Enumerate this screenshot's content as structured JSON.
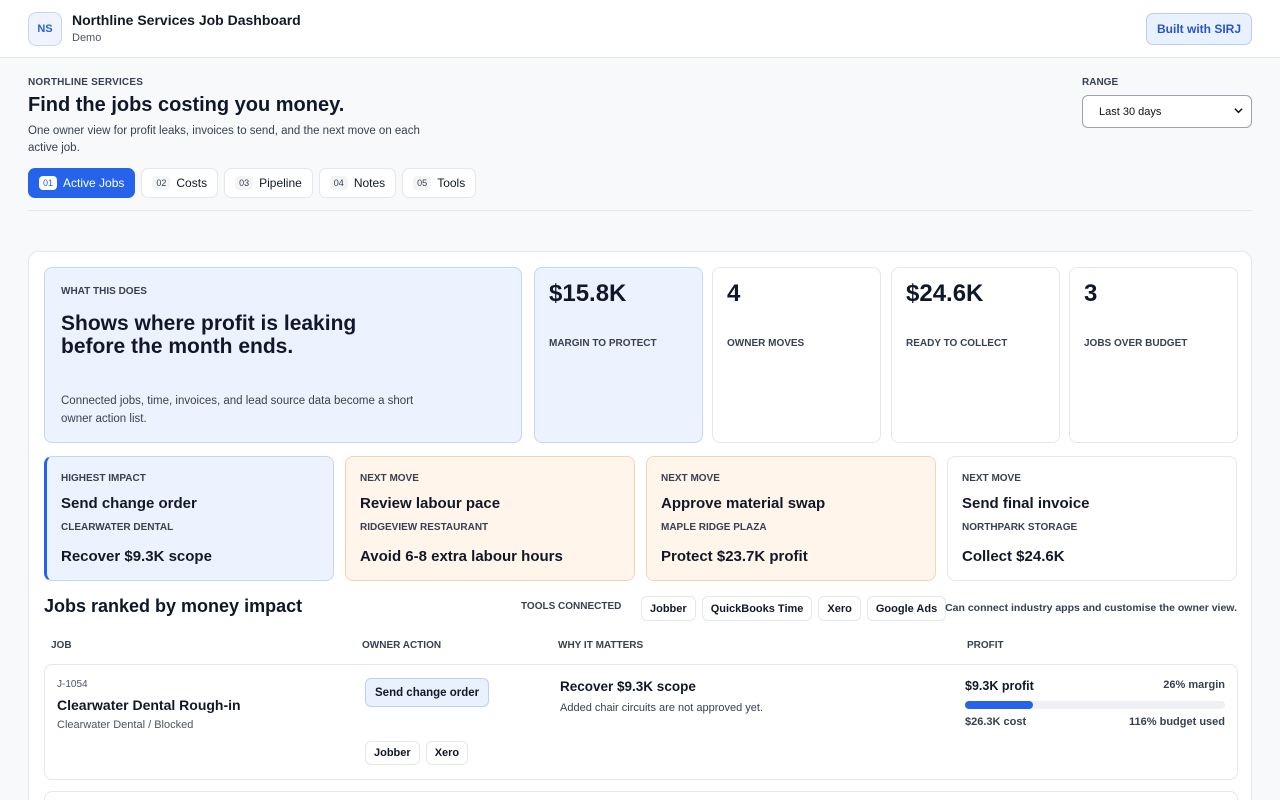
{
  "app": {
    "logo_initials": "NS",
    "title": "Northline Services Job Dashboard",
    "subtitle": "Demo",
    "built_label": "Built with SIRJ"
  },
  "header": {
    "eyebrow": "NORTHLINE SERVICES",
    "headline": "Find the jobs costing you money.",
    "lead": "One owner view for profit leaks, invoices to send, and the next move on each active job.",
    "range_label": "RANGE",
    "range_value": "Last 30 days"
  },
  "tabs": [
    {
      "num": "01",
      "label": "Active Jobs",
      "active": true
    },
    {
      "num": "02",
      "label": "Costs"
    },
    {
      "num": "03",
      "label": "Pipeline"
    },
    {
      "num": "04",
      "label": "Notes"
    },
    {
      "num": "05",
      "label": "Tools"
    }
  ],
  "intro": {
    "eyebrow": "WHAT THIS DOES",
    "headline": "Shows where profit is leaking before the month ends.",
    "description": "Connected jobs, time, invoices, and lead source data become a short owner action list."
  },
  "stats": [
    {
      "value": "$15.8K",
      "label": "MARGIN TO PROTECT",
      "highlight": true
    },
    {
      "value": "4",
      "label": "OWNER MOVES"
    },
    {
      "value": "$24.6K",
      "label": "READY TO COLLECT"
    },
    {
      "value": "3",
      "label": "JOBS OVER BUDGET"
    }
  ],
  "moves": [
    {
      "eyebrow": "HIGHEST IMPACT",
      "title": "Send change order",
      "client": "CLEARWATER DENTAL",
      "outcome": "Recover $9.3K scope",
      "style": "blue"
    },
    {
      "eyebrow": "NEXT MOVE",
      "title": "Review labour pace",
      "client": "RIDGEVIEW RESTAURANT",
      "outcome": "Avoid 6-8 extra labour hours",
      "style": "orange"
    },
    {
      "eyebrow": "NEXT MOVE",
      "title": "Approve material swap",
      "client": "MAPLE RIDGE PLAZA",
      "outcome": "Protect $23.7K profit",
      "style": "orange"
    },
    {
      "eyebrow": "NEXT MOVE",
      "title": "Send final invoice",
      "client": "NORTHPARK STORAGE",
      "outcome": "Collect $24.6K",
      "style": "white"
    }
  ],
  "ranked": {
    "title": "Jobs ranked by money impact",
    "tools_label": "TOOLS CONNECTED",
    "tools": [
      "Jobber",
      "QuickBooks Time",
      "Xero",
      "Google Ads"
    ],
    "tools_note": "Can connect industry apps and customise the owner view.",
    "columns": {
      "job": "JOB",
      "action": "OWNER ACTION",
      "why": "WHY IT MATTERS",
      "profit": "PROFIT"
    },
    "rows": [
      {
        "id": "J-1054",
        "name": "Clearwater Dental Rough-in",
        "meta": "Clearwater Dental / Blocked",
        "action": "Send change order",
        "chips": [
          "Jobber",
          "Xero"
        ],
        "why_title": "Recover $9.3K scope",
        "why_desc": "Added chair circuits are not approved yet.",
        "profit": "$9.3K profit",
        "margin": "26% margin",
        "margin_fraction": 0.26,
        "cost": "$26.3K cost",
        "budget": "116% budget used"
      }
    ]
  },
  "colors": {
    "accent": "#2563eb",
    "highlight_bg": "#edf3fe",
    "warning_bg": "#fff5eb"
  }
}
